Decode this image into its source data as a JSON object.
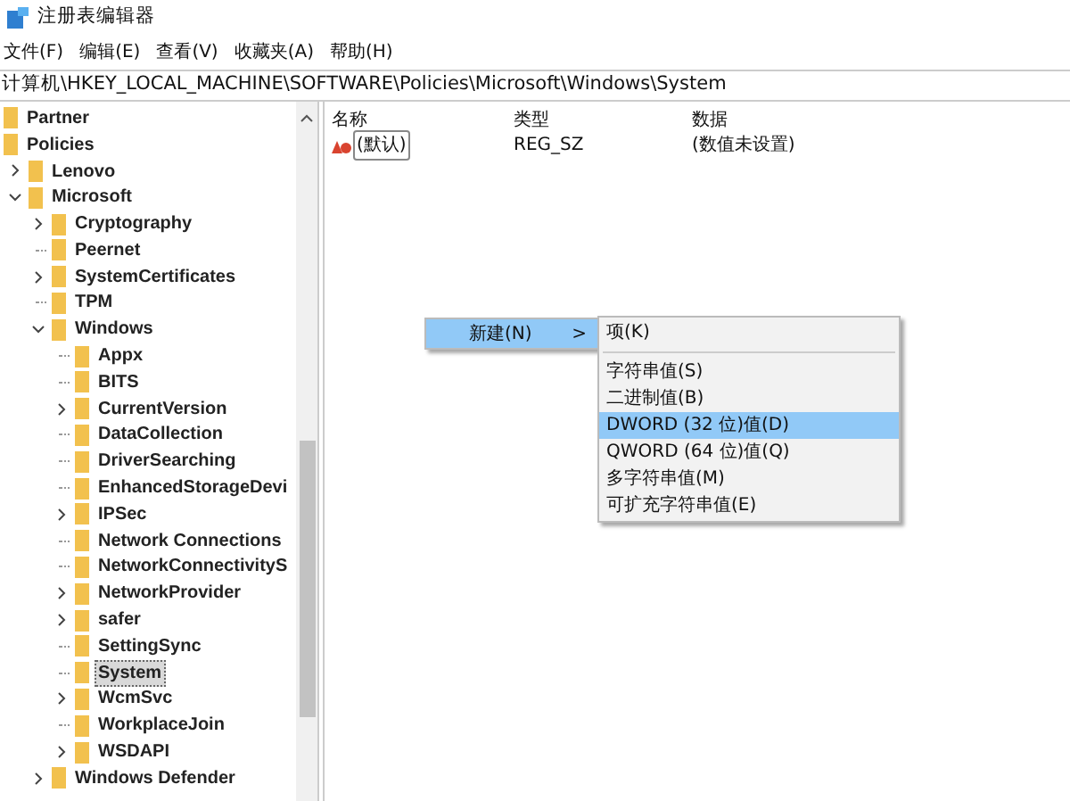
{
  "window": {
    "title": "注册表编辑器"
  },
  "menu_bar": [
    "文件(F)",
    "编辑(E)",
    "查看(V)",
    "收藏夹(A)",
    "帮助(H)"
  ],
  "address_bar": {
    "value": "计算机\\HKEY_LOCAL_MACHINE\\SOFTWARE\\Policies\\Microsoft\\Windows\\System"
  },
  "tree": [
    {
      "label": "Partner",
      "selected": false
    },
    {
      "label": "Policies",
      "selected": false,
      "children": [
        {
          "label": "Lenovo",
          "kind": "branch",
          "expanded": false,
          "selected": false
        },
        {
          "label": "Microsoft",
          "kind": "branch",
          "expanded": true,
          "selected": false,
          "children": [
            {
              "label": "Cryptography",
              "kind": "branch",
              "expanded": false,
              "selected": false
            },
            {
              "label": "Peernet",
              "kind": "leaf",
              "selected": false
            },
            {
              "label": "SystemCertificates",
              "kind": "branch",
              "expanded": false,
              "selected": false
            },
            {
              "label": "TPM",
              "kind": "leaf",
              "selected": false
            },
            {
              "label": "Windows",
              "kind": "branch",
              "expanded": true,
              "selected": false,
              "children": [
                {
                  "label": "Appx",
                  "kind": "leaf",
                  "selected": false
                },
                {
                  "label": "BITS",
                  "kind": "leaf",
                  "selected": false
                },
                {
                  "label": "CurrentVersion",
                  "kind": "branch",
                  "expanded": false,
                  "selected": false
                },
                {
                  "label": "DataCollection",
                  "kind": "leaf",
                  "selected": false
                },
                {
                  "label": "DriverSearching",
                  "kind": "leaf",
                  "selected": false
                },
                {
                  "label": "EnhancedStorageDevi",
                  "kind": "leaf",
                  "selected": false
                },
                {
                  "label": "IPSec",
                  "kind": "branch",
                  "expanded": false,
                  "selected": false
                },
                {
                  "label": "Network Connections",
                  "kind": "leaf",
                  "selected": false
                },
                {
                  "label": "NetworkConnectivityS",
                  "kind": "leaf",
                  "selected": false
                },
                {
                  "label": "NetworkProvider",
                  "kind": "branch",
                  "expanded": false,
                  "selected": false
                },
                {
                  "label": "safer",
                  "kind": "branch",
                  "expanded": false,
                  "selected": false
                },
                {
                  "label": "SettingSync",
                  "kind": "leaf",
                  "selected": false
                },
                {
                  "label": "System",
                  "kind": "leaf",
                  "selected": true
                },
                {
                  "label": "WcmSvc",
                  "kind": "branch",
                  "expanded": false,
                  "selected": false
                },
                {
                  "label": "WorkplaceJoin",
                  "kind": "leaf",
                  "selected": false
                },
                {
                  "label": "WSDAPI",
                  "kind": "branch",
                  "expanded": false,
                  "selected": false
                }
              ]
            },
            {
              "label": "Windows Defender",
              "kind": "branch",
              "expanded": false,
              "selected": false
            }
          ]
        }
      ]
    }
  ],
  "values_table": {
    "columns": [
      "名称",
      "类型",
      "数据"
    ],
    "rows": [
      {
        "name": "(默认)",
        "type": "REG_SZ",
        "data": "(数值未设置)"
      }
    ]
  },
  "context_menu": {
    "items": [
      {
        "label": "新建(N)",
        "arrow": ">",
        "selected": true
      }
    ]
  },
  "submenu": {
    "items": [
      {
        "kind": "item",
        "label": "项(K)",
        "selected": false
      },
      {
        "kind": "separator"
      },
      {
        "kind": "item",
        "label": "字符串值(S)",
        "selected": false
      },
      {
        "kind": "item",
        "label": "二进制值(B)",
        "selected": false
      },
      {
        "kind": "item",
        "label": "DWORD (32 位)值(D)",
        "selected": true
      },
      {
        "kind": "item",
        "label": "QWORD (64 位)值(Q)",
        "selected": false
      },
      {
        "kind": "item",
        "label": "多字符串值(M)",
        "selected": false
      },
      {
        "kind": "item",
        "label": "可扩充字符串值(E)",
        "selected": false
      }
    ]
  }
}
